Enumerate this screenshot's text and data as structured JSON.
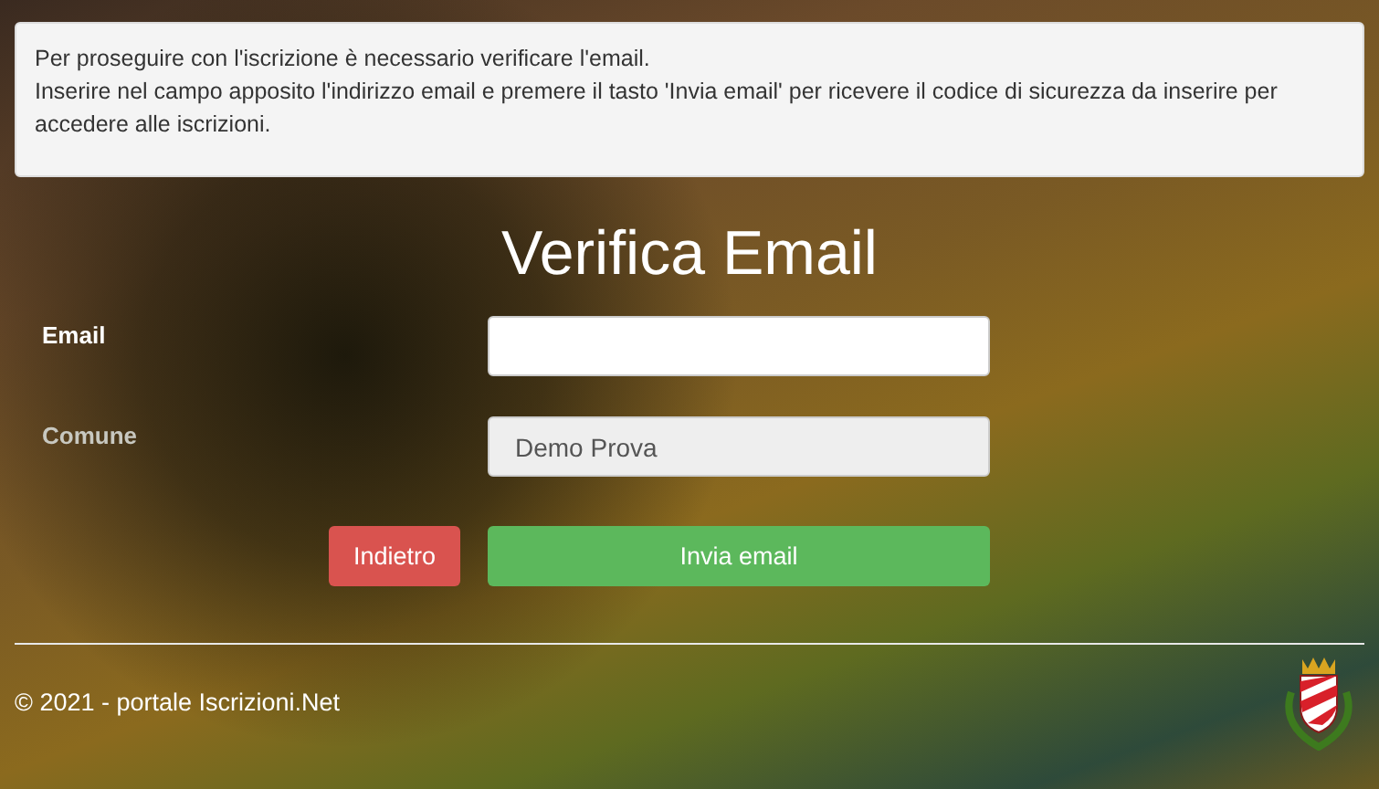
{
  "notice": {
    "lines": [
      "Per proseguire con l'iscrizione è necessario verificare l'email.",
      "Inserire nel campo apposito l'indirizzo email e premere il tasto 'Invia email' per ricevere il codice di sicurezza da inserire per accedere alle iscrizioni."
    ]
  },
  "title": "Verifica Email",
  "fields": [
    {
      "label": "Email",
      "disabled": false
    },
    {
      "label": "Comune",
      "value": "Demo Prova",
      "disabled": true
    }
  ],
  "buttons": [
    {
      "label": "Indietro",
      "kind": "back"
    },
    {
      "label": "Invia email",
      "kind": "submit"
    }
  ],
  "footer": {
    "copyright": "© 2021 - portale Iscrizioni.Net"
  }
}
